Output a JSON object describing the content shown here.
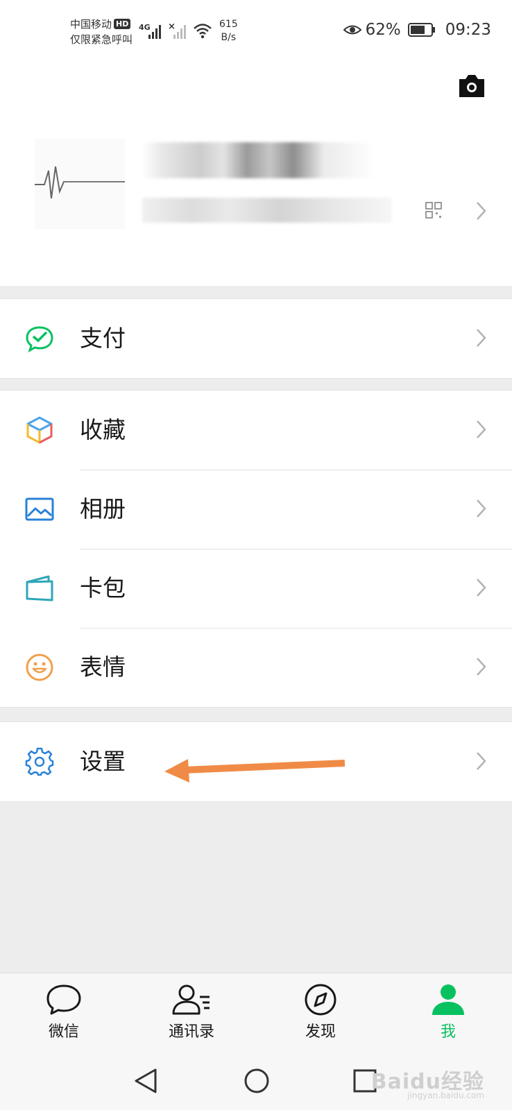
{
  "status_bar": {
    "carrier": "中国移动",
    "carrier_badge": "HD",
    "emergency": "仅限紧急呼叫",
    "network": "4G",
    "speed_value": "615",
    "speed_unit": "B/s",
    "battery": "62%",
    "time": "09:23"
  },
  "menu": {
    "pay": "支付",
    "favorites": "收藏",
    "album": "相册",
    "cards": "卡包",
    "stickers": "表情",
    "settings": "设置"
  },
  "tabs": [
    {
      "label": "微信",
      "icon": "chat-bubble-icon",
      "active": false
    },
    {
      "label": "通讯录",
      "icon": "contacts-icon",
      "active": false
    },
    {
      "label": "发现",
      "icon": "compass-icon",
      "active": false
    },
    {
      "label": "我",
      "icon": "person-icon",
      "active": true
    }
  ],
  "watermark": {
    "brand": "Baidu经验",
    "url": "jingyan.baidu.com"
  },
  "colors": {
    "active_green": "#07c160",
    "pay_green": "#07c160",
    "album_blue": "#2782d7",
    "stickers_orange": "#f0a04b",
    "settings_blue": "#2782d7",
    "arrow_orange": "#f08b47"
  }
}
